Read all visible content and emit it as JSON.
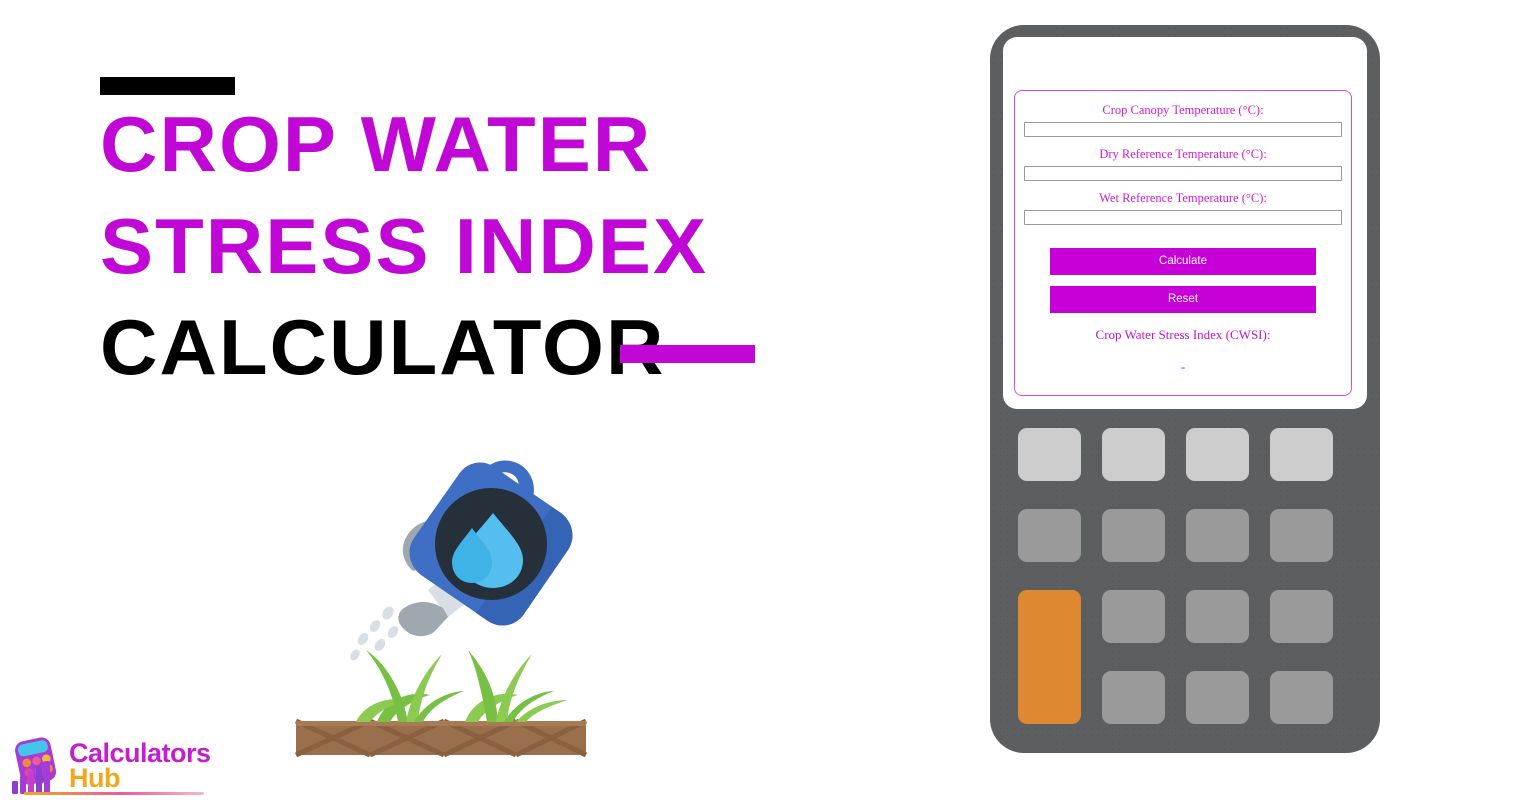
{
  "page": {
    "title_lines": [
      "Crop Water",
      "Stress Index",
      "Calculator"
    ],
    "accent_color": "#C107D6",
    "title_color_line1": "#C107D6",
    "title_color_line2": "#C107D6",
    "title_color_line3": "#000000",
    "rule_top_color": "#000000",
    "rule_bottom_color": "#C107D6",
    "background": "#FFFFFF"
  },
  "logo": {
    "line1": "Calculators",
    "line2": "Hub",
    "line1_color": "#C41ED0",
    "line2_color": "#F0A81E",
    "icon": "calculator-bar-chart-icon"
  },
  "illustration": {
    "name": "watering-can-watering-plants",
    "can_color": "#3F6FC4",
    "spout_color": "#B9BEC2",
    "droplet_color": "#53BEEF",
    "plant_color": "#77C043",
    "soil_color": "#9A6F4C"
  },
  "device": {
    "body_color": "#5D5E60",
    "screen_color": "#FFFFFF",
    "keypad": {
      "rows": 4,
      "cols": 4,
      "top_row_color": "#CDCDCD",
      "key_color": "#9A9A9A",
      "accent_key_color": "#DE8831",
      "accent_key_span": 2
    }
  },
  "calculator": {
    "fields": [
      {
        "label": "Crop Canopy Temperature (°C):",
        "value": "",
        "placeholder": ""
      },
      {
        "label": "Dry Reference Temperature (°C):",
        "value": "",
        "placeholder": ""
      },
      {
        "label": "Wet Reference Temperature (°C):",
        "value": "",
        "placeholder": ""
      }
    ],
    "calculate_label": "Calculate",
    "reset_label": "Reset",
    "result_label": "Crop Water Stress Index (CWSI):",
    "result_value": "-",
    "label_color": "#D11CD8",
    "button_color": "#C800D8",
    "button_text_color": "#FFFFFF",
    "card_border_color": "#D64BE0"
  }
}
